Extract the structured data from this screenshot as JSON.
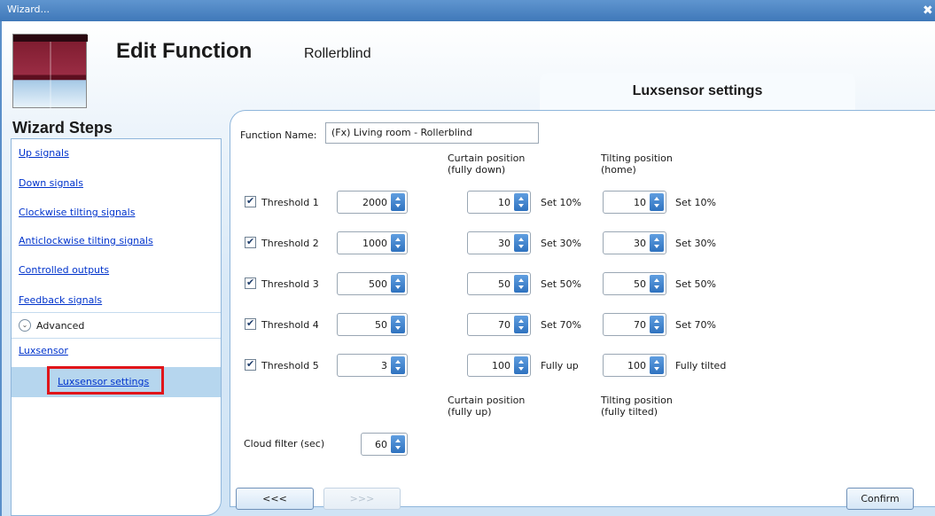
{
  "window": {
    "title": "Wizard...",
    "close_glyph": "✖"
  },
  "header": {
    "title": "Edit Function",
    "function_type": "Rollerblind",
    "section_title": "Luxsensor settings"
  },
  "wizard_steps": {
    "title": "Wizard Steps",
    "items": [
      {
        "label": "Up signals"
      },
      {
        "label": "Down signals"
      },
      {
        "label": "Clockwise tilting signals"
      },
      {
        "label": "Anticlockwise tilting signals"
      },
      {
        "label": "Controlled outputs"
      },
      {
        "label": "Feedback signals"
      }
    ],
    "advanced_label": "Advanced",
    "advanced_toggle_glyph": "⌄",
    "luxsensor_label": "Luxsensor",
    "luxsensor_settings_label": "Luxsensor settings"
  },
  "form": {
    "function_name_label": "Function Name:",
    "function_name_value": "(Fx) Living room - Rollerblind",
    "curtain_header_top": [
      "Curtain position",
      "(fully down)"
    ],
    "tilting_header_top": [
      "Tilting position",
      "(home)"
    ],
    "thresholds": [
      {
        "label": "Threshold 1",
        "checked": true,
        "value": "2000",
        "curtain": "10",
        "curtain_label": "Set 10%",
        "tilt": "10",
        "tilt_label": "Set 10%"
      },
      {
        "label": "Threshold 2",
        "checked": true,
        "value": "1000",
        "curtain": "30",
        "curtain_label": "Set 30%",
        "tilt": "30",
        "tilt_label": "Set 30%"
      },
      {
        "label": "Threshold 3",
        "checked": true,
        "value": "500",
        "curtain": "50",
        "curtain_label": "Set 50%",
        "tilt": "50",
        "tilt_label": "Set 50%"
      },
      {
        "label": "Threshold 4",
        "checked": true,
        "value": "50",
        "curtain": "70",
        "curtain_label": "Set 70%",
        "tilt": "70",
        "tilt_label": "Set 70%"
      },
      {
        "label": "Threshold 5",
        "checked": true,
        "value": "3",
        "curtain": "100",
        "curtain_label": "Fully up",
        "tilt": "100",
        "tilt_label": "Fully tilted"
      }
    ],
    "curtain_header_bottom": [
      "Curtain position",
      "(fully up)"
    ],
    "tilting_header_bottom": [
      "Tilting position",
      "(fully tilted)"
    ],
    "cloud_filter_label": "Cloud filter (sec)",
    "cloud_filter_value": "60"
  },
  "footer": {
    "back_label": "<<<",
    "next_label": ">>>",
    "confirm_label": "Confirm"
  },
  "colors": {
    "accent": "#3f78b9",
    "link": "#0033cc",
    "highlight": "#e0151a",
    "spinner": "#2f72bf"
  }
}
